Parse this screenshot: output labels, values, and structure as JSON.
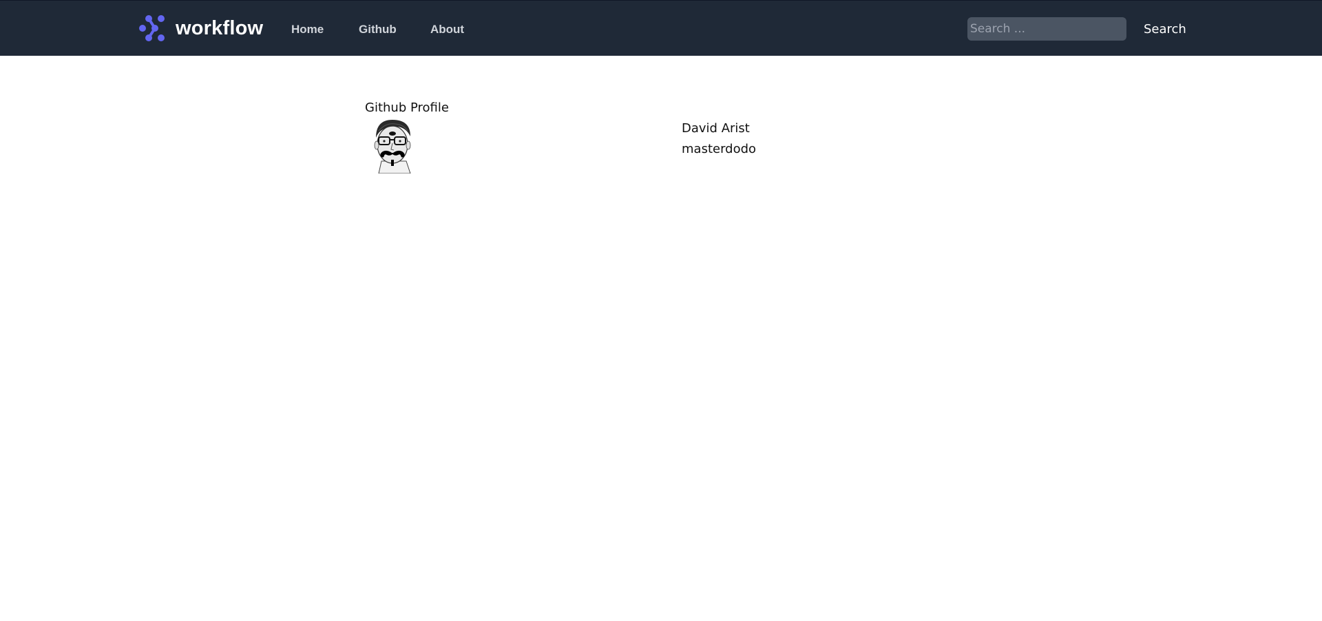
{
  "navbar": {
    "brand": "workflow",
    "brand_logo_icon": "workflow-logo-icon",
    "brand_color": "#6366f1",
    "links": [
      "Home",
      "Github",
      "About"
    ],
    "search_placeholder": "Search ...",
    "search_button": "Search",
    "background": "#1f2937"
  },
  "profile": {
    "heading": "Github Profile",
    "avatar_icon": "avatar-sketch-portrait",
    "name": "David Arist",
    "login": "masterdodo"
  }
}
